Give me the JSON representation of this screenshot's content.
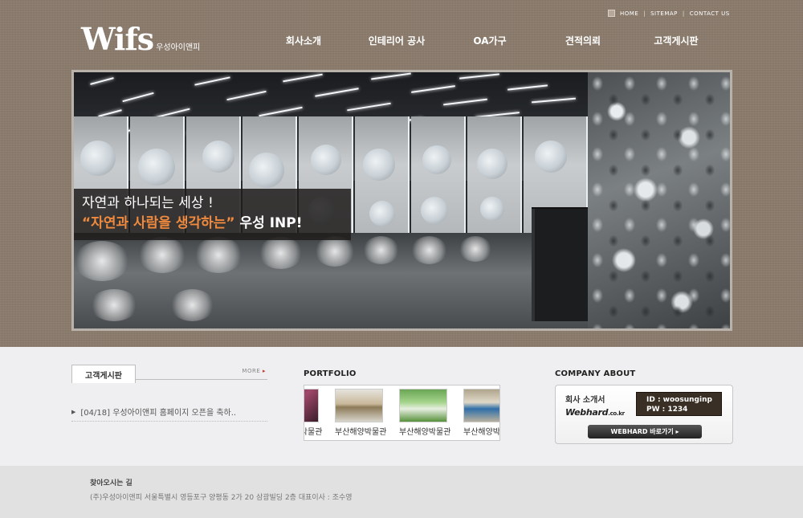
{
  "utility_nav": {
    "home": "HOME",
    "sitemap": "SITEMAP",
    "contact": "CONTACT US",
    "separator": "|"
  },
  "logo": {
    "mark": "Wifs",
    "subtitle": "우성아이앤피"
  },
  "main_nav": [
    {
      "label": "회사소개"
    },
    {
      "label": "인테리어 공사"
    },
    {
      "label": "OA가구"
    },
    {
      "label": "견적의뢰"
    },
    {
      "label": "고객게시판"
    }
  ],
  "banner": {
    "caption_line1": "자연과 하나되는 세상 !",
    "caption_quote": "“자연과 사람을 생각하는”",
    "caption_brand": "우성 INP!"
  },
  "board": {
    "tab_label": "고객게시판",
    "more_label": "MORE",
    "items": [
      {
        "text": "[04/18] 우성아이앤피 홈페이지 오픈을 축하.."
      }
    ]
  },
  "portfolio": {
    "title": "PORTFOLIO",
    "items": [
      {
        "label": "부산해양박물관"
      },
      {
        "label": "부산해양박물관"
      },
      {
        "label": "부산해양박물관"
      },
      {
        "label": "부산해양박물관"
      }
    ]
  },
  "company": {
    "title": "COMPANY ABOUT",
    "intro_label": "회사 소개서",
    "webhard_logo": "Webhard",
    "webhard_logo_suffix": ".co.kr",
    "id_line": "ID  : woosunginp",
    "pw_line": "PW : 1234",
    "button_label": "WEBHARD  바로가기  ▸"
  },
  "footer": {
    "title": "찾아오시는 길",
    "info": "(주)우성아이앤피    서울특별시 영등포구 양평동 2가 20 삼광빌딩 2층   대표이사 : 조수영"
  },
  "colors": {
    "header_bg": "#8b7c6d",
    "caption_accent": "#f08a3e",
    "logo_dot": "#c9352b",
    "footer_bg": "#e1e1e2"
  }
}
